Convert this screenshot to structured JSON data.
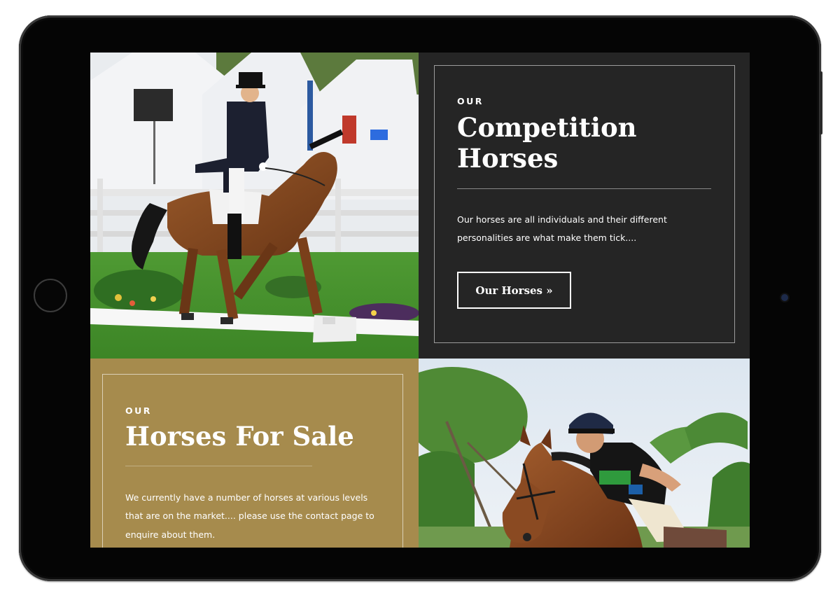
{
  "competition": {
    "eyebrow": "OUR",
    "title_line1": "Competition",
    "title_line2": "Horses",
    "description_line1": "Our horses are all individuals and their different",
    "description_line2": "personalities are what make them tick....",
    "button_label": "Our Horses »"
  },
  "sale": {
    "eyebrow": "OUR",
    "title": "Horses For Sale",
    "description_line1": "We currently have a number of horses at various levels",
    "description_line2": "that are on the market.... please use the contact page to",
    "description_line3": "enquire about them."
  },
  "colors": {
    "dark_panel": "#252525",
    "gold_panel": "#a68b4d",
    "device_bezel": "#050505"
  }
}
